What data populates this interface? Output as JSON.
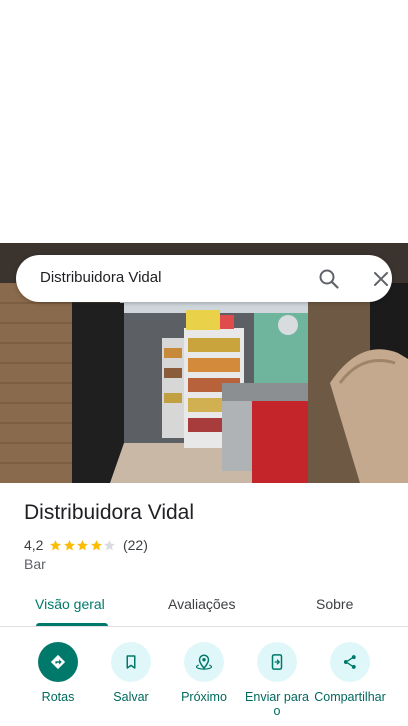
{
  "search": {
    "query": "Distribuidora Vidal"
  },
  "place": {
    "name": "Distribuidora Vidal",
    "rating": "4,2",
    "stars": 4.2,
    "reviews": "(22)",
    "category": "Bar"
  },
  "tabs": [
    {
      "label": "Visão geral",
      "active": true
    },
    {
      "label": "Avaliações",
      "active": false
    },
    {
      "label": "Sobre",
      "active": false
    }
  ],
  "actions": [
    {
      "label": "Rotas",
      "icon": "directions-icon"
    },
    {
      "label": "Salvar",
      "icon": "bookmark-icon"
    },
    {
      "label": "Próximo",
      "icon": "nearby-icon"
    },
    {
      "label": "Enviar para o",
      "icon": "send-to-phone-icon"
    },
    {
      "label": "Compartilhar",
      "icon": "share-icon"
    }
  ],
  "colors": {
    "accent": "#00796b",
    "action_bg": "#e0f7f9",
    "star": "#fbbc04"
  }
}
